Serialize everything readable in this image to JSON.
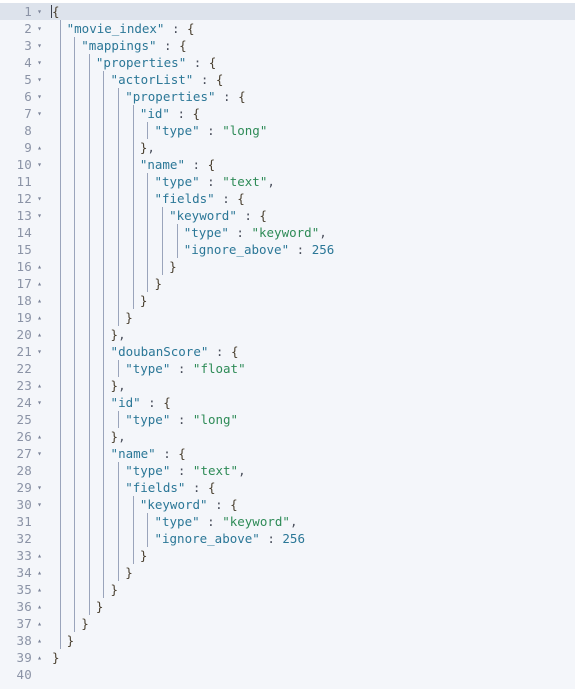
{
  "editor": {
    "language": "json",
    "total_lines": 40,
    "active_line": 1,
    "colors": {
      "background": "#f4f6fa",
      "active_line": "#dde3ec",
      "line_number": "#8b93a6",
      "key_string": "#2b7797",
      "value_string": "#2e8b57",
      "number": "#2b7797",
      "punctuation": "#4a4f5c",
      "brace": "#4a4030",
      "indent_guide": "#9aa4bb"
    },
    "fold_icons": {
      "open": "▾",
      "close": "▴"
    },
    "lines": [
      {
        "num": 1,
        "fold": "open",
        "indent": 0,
        "guides": 0,
        "tokens": [
          {
            "t": "{",
            "c": "b"
          }
        ]
      },
      {
        "num": 2,
        "fold": "open",
        "indent": 2,
        "guides": 1,
        "tokens": [
          {
            "t": "\"movie_index\"",
            "c": "k"
          },
          {
            "t": " : ",
            "c": "p"
          },
          {
            "t": "{",
            "c": "b"
          }
        ]
      },
      {
        "num": 3,
        "fold": "open",
        "indent": 4,
        "guides": 2,
        "tokens": [
          {
            "t": "\"mappings\"",
            "c": "k"
          },
          {
            "t": " : ",
            "c": "p"
          },
          {
            "t": "{",
            "c": "b"
          }
        ]
      },
      {
        "num": 4,
        "fold": "open",
        "indent": 6,
        "guides": 3,
        "tokens": [
          {
            "t": "\"properties\"",
            "c": "k"
          },
          {
            "t": " : ",
            "c": "p"
          },
          {
            "t": "{",
            "c": "b"
          }
        ]
      },
      {
        "num": 5,
        "fold": "open",
        "indent": 8,
        "guides": 4,
        "tokens": [
          {
            "t": "\"actorList\"",
            "c": "k"
          },
          {
            "t": " : ",
            "c": "p"
          },
          {
            "t": "{",
            "c": "b"
          }
        ]
      },
      {
        "num": 6,
        "fold": "open",
        "indent": 10,
        "guides": 5,
        "tokens": [
          {
            "t": "\"properties\"",
            "c": "k"
          },
          {
            "t": " : ",
            "c": "p"
          },
          {
            "t": "{",
            "c": "b"
          }
        ]
      },
      {
        "num": 7,
        "fold": "open",
        "indent": 12,
        "guides": 6,
        "tokens": [
          {
            "t": "\"id\"",
            "c": "k"
          },
          {
            "t": " : ",
            "c": "p"
          },
          {
            "t": "{",
            "c": "b"
          }
        ]
      },
      {
        "num": 8,
        "fold": "none",
        "indent": 14,
        "guides": 7,
        "tokens": [
          {
            "t": "\"type\"",
            "c": "k"
          },
          {
            "t": " : ",
            "c": "p"
          },
          {
            "t": "\"long\"",
            "c": "s"
          }
        ]
      },
      {
        "num": 9,
        "fold": "close",
        "indent": 12,
        "guides": 6,
        "tokens": [
          {
            "t": "}",
            "c": "b"
          },
          {
            "t": ",",
            "c": "p"
          }
        ]
      },
      {
        "num": 10,
        "fold": "open",
        "indent": 12,
        "guides": 6,
        "tokens": [
          {
            "t": "\"name\"",
            "c": "k"
          },
          {
            "t": " : ",
            "c": "p"
          },
          {
            "t": "{",
            "c": "b"
          }
        ]
      },
      {
        "num": 11,
        "fold": "none",
        "indent": 14,
        "guides": 7,
        "tokens": [
          {
            "t": "\"type\"",
            "c": "k"
          },
          {
            "t": " : ",
            "c": "p"
          },
          {
            "t": "\"text\"",
            "c": "s"
          },
          {
            "t": ",",
            "c": "p"
          }
        ]
      },
      {
        "num": 12,
        "fold": "open",
        "indent": 14,
        "guides": 7,
        "tokens": [
          {
            "t": "\"fields\"",
            "c": "k"
          },
          {
            "t": " : ",
            "c": "p"
          },
          {
            "t": "{",
            "c": "b"
          }
        ]
      },
      {
        "num": 13,
        "fold": "open",
        "indent": 16,
        "guides": 8,
        "tokens": [
          {
            "t": "\"keyword\"",
            "c": "k"
          },
          {
            "t": " : ",
            "c": "p"
          },
          {
            "t": "{",
            "c": "b"
          }
        ]
      },
      {
        "num": 14,
        "fold": "none",
        "indent": 18,
        "guides": 9,
        "tokens": [
          {
            "t": "\"type\"",
            "c": "k"
          },
          {
            "t": " : ",
            "c": "p"
          },
          {
            "t": "\"keyword\"",
            "c": "s"
          },
          {
            "t": ",",
            "c": "p"
          }
        ]
      },
      {
        "num": 15,
        "fold": "none",
        "indent": 18,
        "guides": 9,
        "tokens": [
          {
            "t": "\"ignore_above\"",
            "c": "k"
          },
          {
            "t": " : ",
            "c": "p"
          },
          {
            "t": "256",
            "c": "n"
          }
        ]
      },
      {
        "num": 16,
        "fold": "close",
        "indent": 16,
        "guides": 8,
        "tokens": [
          {
            "t": "}",
            "c": "b"
          }
        ]
      },
      {
        "num": 17,
        "fold": "close",
        "indent": 14,
        "guides": 7,
        "tokens": [
          {
            "t": "}",
            "c": "b"
          }
        ]
      },
      {
        "num": 18,
        "fold": "close",
        "indent": 12,
        "guides": 6,
        "tokens": [
          {
            "t": "}",
            "c": "b"
          }
        ]
      },
      {
        "num": 19,
        "fold": "close",
        "indent": 10,
        "guides": 5,
        "tokens": [
          {
            "t": "}",
            "c": "b"
          }
        ]
      },
      {
        "num": 20,
        "fold": "close",
        "indent": 8,
        "guides": 4,
        "tokens": [
          {
            "t": "}",
            "c": "b"
          },
          {
            "t": ",",
            "c": "p"
          }
        ]
      },
      {
        "num": 21,
        "fold": "open",
        "indent": 8,
        "guides": 4,
        "tokens": [
          {
            "t": "\"doubanScore\"",
            "c": "k"
          },
          {
            "t": " : ",
            "c": "p"
          },
          {
            "t": "{",
            "c": "b"
          }
        ]
      },
      {
        "num": 22,
        "fold": "none",
        "indent": 10,
        "guides": 5,
        "tokens": [
          {
            "t": "\"type\"",
            "c": "k"
          },
          {
            "t": " : ",
            "c": "p"
          },
          {
            "t": "\"float\"",
            "c": "s"
          }
        ]
      },
      {
        "num": 23,
        "fold": "close",
        "indent": 8,
        "guides": 4,
        "tokens": [
          {
            "t": "}",
            "c": "b"
          },
          {
            "t": ",",
            "c": "p"
          }
        ]
      },
      {
        "num": 24,
        "fold": "open",
        "indent": 8,
        "guides": 4,
        "tokens": [
          {
            "t": "\"id\"",
            "c": "k"
          },
          {
            "t": " : ",
            "c": "p"
          },
          {
            "t": "{",
            "c": "b"
          }
        ]
      },
      {
        "num": 25,
        "fold": "none",
        "indent": 10,
        "guides": 5,
        "tokens": [
          {
            "t": "\"type\"",
            "c": "k"
          },
          {
            "t": " : ",
            "c": "p"
          },
          {
            "t": "\"long\"",
            "c": "s"
          }
        ]
      },
      {
        "num": 26,
        "fold": "close",
        "indent": 8,
        "guides": 4,
        "tokens": [
          {
            "t": "}",
            "c": "b"
          },
          {
            "t": ",",
            "c": "p"
          }
        ]
      },
      {
        "num": 27,
        "fold": "open",
        "indent": 8,
        "guides": 4,
        "tokens": [
          {
            "t": "\"name\"",
            "c": "k"
          },
          {
            "t": " : ",
            "c": "p"
          },
          {
            "t": "{",
            "c": "b"
          }
        ]
      },
      {
        "num": 28,
        "fold": "none",
        "indent": 10,
        "guides": 5,
        "tokens": [
          {
            "t": "\"type\"",
            "c": "k"
          },
          {
            "t": " : ",
            "c": "p"
          },
          {
            "t": "\"text\"",
            "c": "s"
          },
          {
            "t": ",",
            "c": "p"
          }
        ]
      },
      {
        "num": 29,
        "fold": "open",
        "indent": 10,
        "guides": 5,
        "tokens": [
          {
            "t": "\"fields\"",
            "c": "k"
          },
          {
            "t": " : ",
            "c": "p"
          },
          {
            "t": "{",
            "c": "b"
          }
        ]
      },
      {
        "num": 30,
        "fold": "open",
        "indent": 12,
        "guides": 6,
        "tokens": [
          {
            "t": "\"keyword\"",
            "c": "k"
          },
          {
            "t": " : ",
            "c": "p"
          },
          {
            "t": "{",
            "c": "b"
          }
        ]
      },
      {
        "num": 31,
        "fold": "none",
        "indent": 14,
        "guides": 7,
        "tokens": [
          {
            "t": "\"type\"",
            "c": "k"
          },
          {
            "t": " : ",
            "c": "p"
          },
          {
            "t": "\"keyword\"",
            "c": "s"
          },
          {
            "t": ",",
            "c": "p"
          }
        ]
      },
      {
        "num": 32,
        "fold": "none",
        "indent": 14,
        "guides": 7,
        "tokens": [
          {
            "t": "\"ignore_above\"",
            "c": "k"
          },
          {
            "t": " : ",
            "c": "p"
          },
          {
            "t": "256",
            "c": "n"
          }
        ]
      },
      {
        "num": 33,
        "fold": "close",
        "indent": 12,
        "guides": 6,
        "tokens": [
          {
            "t": "}",
            "c": "b"
          }
        ]
      },
      {
        "num": 34,
        "fold": "close",
        "indent": 10,
        "guides": 5,
        "tokens": [
          {
            "t": "}",
            "c": "b"
          }
        ]
      },
      {
        "num": 35,
        "fold": "close",
        "indent": 8,
        "guides": 4,
        "tokens": [
          {
            "t": "}",
            "c": "b"
          }
        ]
      },
      {
        "num": 36,
        "fold": "close",
        "indent": 6,
        "guides": 3,
        "tokens": [
          {
            "t": "}",
            "c": "b"
          }
        ]
      },
      {
        "num": 37,
        "fold": "close",
        "indent": 4,
        "guides": 2,
        "tokens": [
          {
            "t": "}",
            "c": "b"
          }
        ]
      },
      {
        "num": 38,
        "fold": "close",
        "indent": 2,
        "guides": 1,
        "tokens": [
          {
            "t": "}",
            "c": "b"
          }
        ]
      },
      {
        "num": 39,
        "fold": "close",
        "indent": 0,
        "guides": 0,
        "tokens": [
          {
            "t": "}",
            "c": "b"
          }
        ]
      },
      {
        "num": 40,
        "fold": "none",
        "indent": 0,
        "guides": 0,
        "tokens": []
      }
    ]
  }
}
